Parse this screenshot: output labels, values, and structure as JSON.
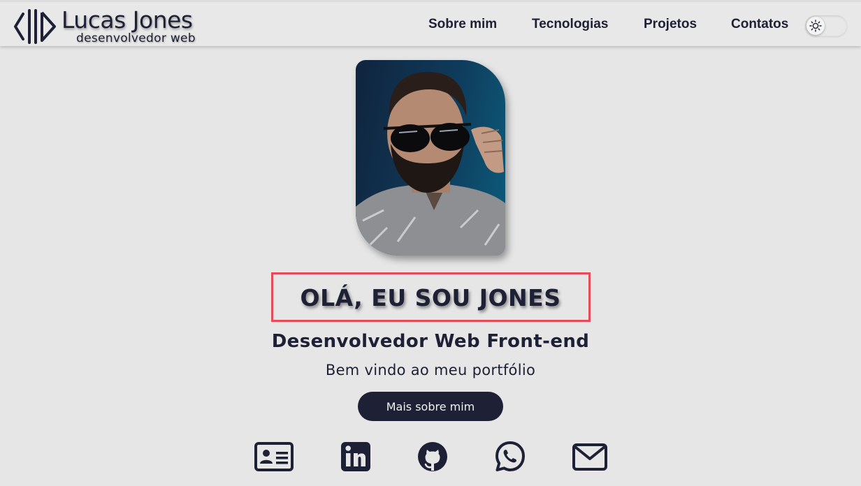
{
  "header": {
    "logo": {
      "name": "Lucas Jones",
      "subtitle": "desenvolvedor web"
    },
    "nav": [
      {
        "label": "Sobre mim"
      },
      {
        "label": "Tecnologias"
      },
      {
        "label": "Projetos"
      },
      {
        "label": "Contatos"
      }
    ],
    "theme_toggle": {
      "icon": "sun-icon",
      "state": "light"
    }
  },
  "hero": {
    "photo": {
      "subject": "portrait-photo"
    },
    "headline": "OLÁ, EU SOU JONES",
    "role": "Desenvolvedor Web Front-end",
    "welcome": "Bem vindo ao meu portfólio",
    "cta_label": "Mais sobre mim"
  },
  "social": [
    {
      "icon": "id-card-icon"
    },
    {
      "icon": "linkedin-icon"
    },
    {
      "icon": "github-icon"
    },
    {
      "icon": "whatsapp-icon"
    },
    {
      "icon": "email-icon"
    }
  ],
  "colors": {
    "background": "#e6e6e6",
    "primary": "#1e2035",
    "highlight_border": "#e64b5a",
    "button_text": "#f2f2f2"
  }
}
